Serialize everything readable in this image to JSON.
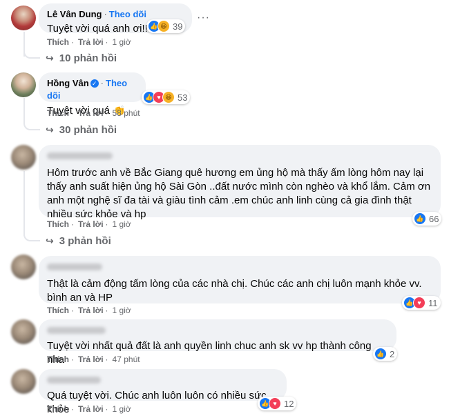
{
  "comments": [
    {
      "author": "Lê Vân Dung",
      "follow": "Theo dõi",
      "text": "Tuyệt vời quá anh ơi!!",
      "like": "Thích",
      "reply": "Trả lời",
      "time": "1 giờ",
      "reactions": [
        "like",
        "haha"
      ],
      "reaction_count": "39",
      "replies": "10 phản hồi",
      "more_icon": "more-dots-icon"
    },
    {
      "author": "Hồng Vân",
      "verified": true,
      "follow": "Theo dõi",
      "text": "Tuyệt vời quá",
      "emoji": "👏",
      "like": "Thích",
      "reply": "Trả lời",
      "time": "58 phút",
      "reactions": [
        "like",
        "love",
        "haha"
      ],
      "reaction_count": "53",
      "replies": "30 phản hồi"
    },
    {
      "text": "Hôm trước anh về Bắc Giang quê hương em ủng hộ mà thấy ấm lòng hôm nay lại thấy anh suất hiện ủng hộ Sài Gòn ..đất nước mình còn nghèo và khổ lắm. Cảm ơn anh một nghệ sĩ đa tài và giàu tình cảm .em chúc anh linh cùng cả gia đình thật nhiều sức khỏe và hp",
      "like": "Thích",
      "reply": "Trả lời",
      "time": "1 giờ",
      "reactions": [
        "like"
      ],
      "reaction_count": "66",
      "replies": "3 phản hồi"
    },
    {
      "text": "Thật là cảm động tấm lòng của các nhà chị. Chúc các anh chị luôn mạnh khỏe vv. bình an và HP",
      "like": "Thích",
      "reply": "Trả lời",
      "time": "1 giờ",
      "reactions": [
        "like",
        "love"
      ],
      "reaction_count": "11"
    },
    {
      "text": "Tuyệt vời nhất quả đất là anh quyền linh chuc anh sk vv hp thành công nha",
      "like": "Thích",
      "reply": "Trả lời",
      "time": "47 phút",
      "reactions": [
        "like"
      ],
      "reaction_count": "2"
    },
    {
      "text": "Quá tuyệt vời. Chúc anh luôn luôn có nhiều sức khỏe",
      "like": "Thích",
      "reply": "Trả lời",
      "time": "1 giờ",
      "reactions": [
        "like",
        "love"
      ],
      "reaction_count": "12"
    }
  ],
  "colors": {
    "bubble": "#f0f2f5",
    "follow": "#1877f2",
    "meta": "#65676b",
    "like_reaction": "#1877f2",
    "love_reaction": "#f33e58",
    "haha_reaction": "#f7b125"
  }
}
